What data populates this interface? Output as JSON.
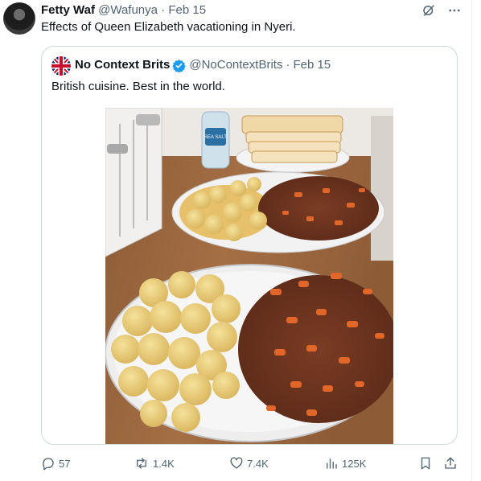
{
  "tweet": {
    "author_name": "Fetty Waf",
    "handle": "@Wafunya",
    "separator": "·",
    "date": "Feb 15",
    "text": "Effects of Queen Elizabeth vacationing in Nyeri.",
    "top_icons": [
      "grok-icon",
      "more-icon"
    ]
  },
  "quote": {
    "author_name": "No Context Brits",
    "verified": true,
    "handle": "@NoContextBrits",
    "separator": "·",
    "date": "Feb 15",
    "text": "British cuisine. Best in the world.",
    "photo_label": "SEA SALT"
  },
  "actions": {
    "replies": "57",
    "reposts": "1.4K",
    "likes": "7.4K",
    "views": "125K"
  },
  "colors": {
    "text": "#0f1419",
    "muted": "#536471",
    "border": "#cfd9de",
    "verified": "#1d9bf0"
  }
}
